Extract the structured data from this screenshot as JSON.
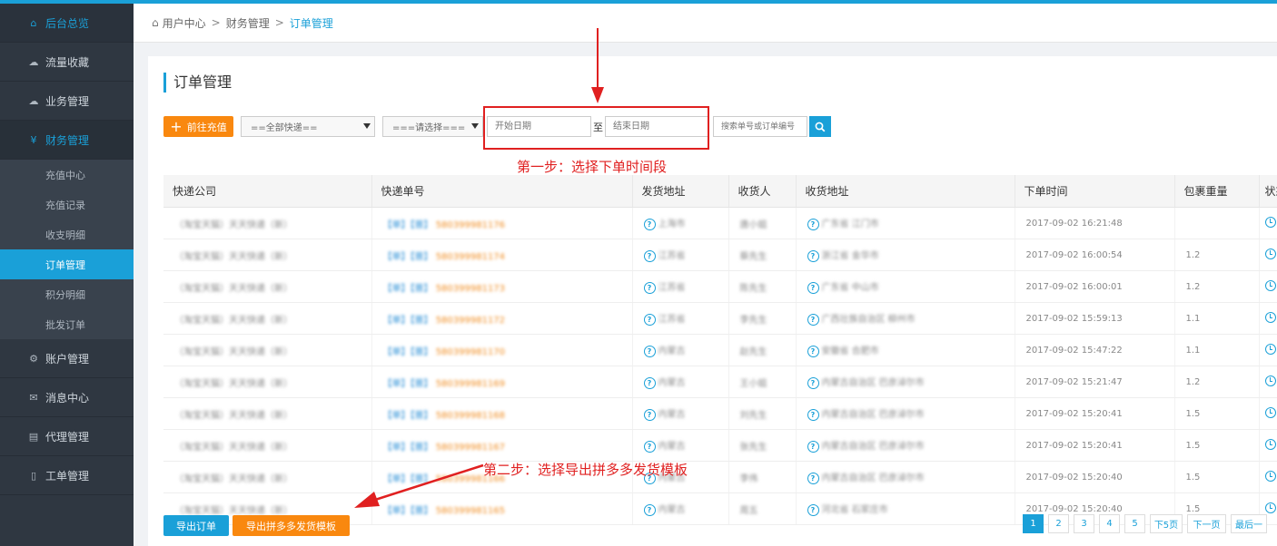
{
  "sidebar": {
    "items": [
      {
        "label": "后台总览",
        "icon": "home-icon"
      },
      {
        "label": "流量收藏",
        "icon": "cloud-icon"
      },
      {
        "label": "业务管理",
        "icon": "cloud-icon"
      },
      {
        "label": "财务管理",
        "icon": "yen-icon"
      },
      {
        "label": "账户管理",
        "icon": "gears-icon"
      },
      {
        "label": "消息中心",
        "icon": "envelope-icon"
      },
      {
        "label": "代理管理",
        "icon": "server-icon"
      },
      {
        "label": "工单管理",
        "icon": "clipboard-icon"
      }
    ],
    "sub_items": [
      "充值中心",
      "充值记录",
      "收支明细",
      "订单管理",
      "积分明细",
      "批发订单"
    ]
  },
  "breadcrumb": {
    "home": "用户中心",
    "level1": "财务管理",
    "current": "订单管理",
    "separator": ">"
  },
  "page_title": "订单管理",
  "toolbar": {
    "recharge_label": "前往充值",
    "express_select": "==全部快递==",
    "option_select": "===请选择===",
    "start_date_placeholder": "开始日期",
    "to_label": "至",
    "end_date_placeholder": "结束日期",
    "search_placeholder": "搜索单号或订单编号"
  },
  "table": {
    "headers": [
      "快递公司",
      "快递单号",
      "发货地址",
      "收货人",
      "收货地址",
      "下单时间",
      "包裹重量",
      "状态"
    ],
    "rows": [
      {
        "company": "（淘宝天猫）天天快递（新）",
        "tag": "【单】【普】",
        "tracking": "580399981176",
        "from": "上海市",
        "receiver": "唐小姐",
        "to": "广东省 江门市",
        "time": "2017-09-02 16:21:48",
        "weight": ""
      },
      {
        "company": "（淘宝天猫）天天快递（新）",
        "tag": "【单】【普】",
        "tracking": "580399981174",
        "from": "江苏省",
        "receiver": "蔡先生",
        "to": "浙江省 金华市",
        "time": "2017-09-02 16:00:54",
        "weight": "1.2"
      },
      {
        "company": "（淘宝天猫）天天快递（新）",
        "tag": "【单】【普】",
        "tracking": "580399981173",
        "from": "江苏省",
        "receiver": "陈先生",
        "to": "广东省 中山市",
        "time": "2017-09-02 16:00:01",
        "weight": "1.2"
      },
      {
        "company": "（淘宝天猫）天天快递（新）",
        "tag": "【单】【普】",
        "tracking": "580399981172",
        "from": "江苏省",
        "receiver": "李先生",
        "to": "广西壮族自治区 柳州市",
        "time": "2017-09-02 15:59:13",
        "weight": "1.1"
      },
      {
        "company": "（淘宝天猫）天天快递（新）",
        "tag": "【单】【普】",
        "tracking": "580399981170",
        "from": "内蒙古",
        "receiver": "赵先生",
        "to": "安徽省 合肥市",
        "time": "2017-09-02 15:47:22",
        "weight": "1.1"
      },
      {
        "company": "（淘宝天猫）天天快递（新）",
        "tag": "【单】【普】",
        "tracking": "580399981169",
        "from": "内蒙古",
        "receiver": "王小姐",
        "to": "内蒙古自治区 巴彦淖尔市",
        "time": "2017-09-02 15:21:47",
        "weight": "1.2"
      },
      {
        "company": "（淘宝天猫）天天快递（新）",
        "tag": "【单】【普】",
        "tracking": "580399981168",
        "from": "内蒙古",
        "receiver": "刘先生",
        "to": "内蒙古自治区 巴彦淖尔市",
        "time": "2017-09-02 15:20:41",
        "weight": "1.5"
      },
      {
        "company": "（淘宝天猫）天天快递（新）",
        "tag": "【单】【普】",
        "tracking": "580399981167",
        "from": "内蒙古",
        "receiver": "张先生",
        "to": "内蒙古自治区 巴彦淖尔市",
        "time": "2017-09-02 15:20:41",
        "weight": "1.5"
      },
      {
        "company": "（淘宝天猫）天天快递（新）",
        "tag": "【单】【普】",
        "tracking": "580399981166",
        "from": "内蒙古",
        "receiver": "李伟",
        "to": "内蒙古自治区 巴彦淖尔市",
        "time": "2017-09-02 15:20:40",
        "weight": "1.5"
      },
      {
        "company": "（淘宝天猫）天天快递（新）",
        "tag": "【单】【普】",
        "tracking": "580399981165",
        "from": "内蒙古",
        "receiver": "周五",
        "to": "河北省 石家庄市",
        "time": "2017-09-02 15:20:40",
        "weight": "1.5"
      }
    ]
  },
  "footer": {
    "export_label": "导出订单",
    "export_pdd_label": "导出拼多多发货模板"
  },
  "pagination": {
    "pages": [
      "1",
      "2",
      "3",
      "4",
      "5"
    ],
    "next5": "下5页",
    "next": "下一页",
    "last": "最后一"
  },
  "annotations": {
    "step1": "第一步：选择下单时间段",
    "step2": "第二步：选择导出拼多多发货模板",
    "color": "#e02020"
  }
}
